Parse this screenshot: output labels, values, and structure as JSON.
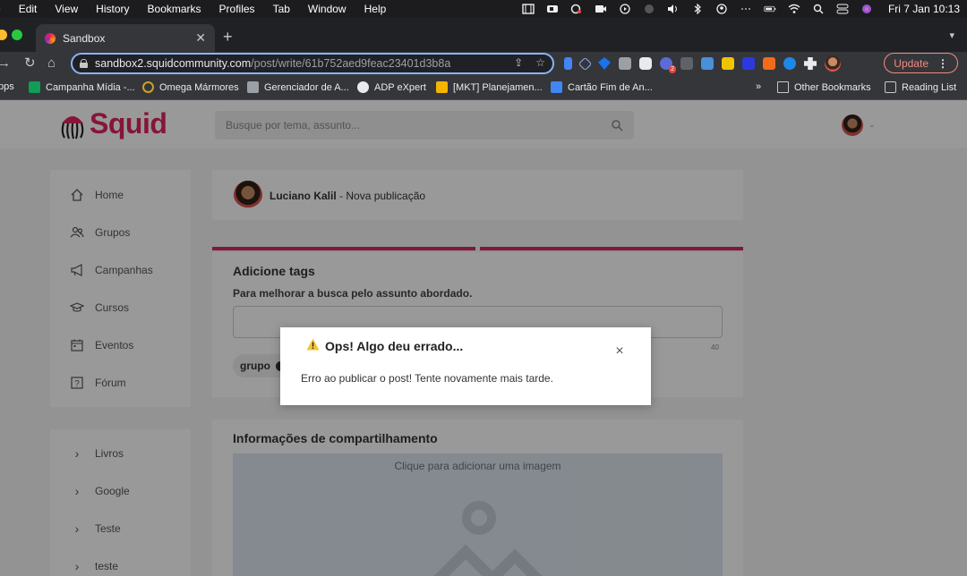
{
  "menubar": {
    "app_partial": "e",
    "items": [
      "Edit",
      "View",
      "History",
      "Bookmarks",
      "Profiles",
      "Tab",
      "Window",
      "Help"
    ],
    "clock": "Fri 7 Jan  10:13"
  },
  "tab": {
    "title": "Sandbox"
  },
  "omnibox": {
    "host": "sandbox2.squidcommunity.com",
    "path": "/post/write/61b752aed9feac23401d3b8a"
  },
  "toolbar": {
    "update_label": "Update",
    "extension_badge": "2"
  },
  "bookmarks": {
    "apps_partial": "pps",
    "items": [
      "Campanha Mídia -...",
      "Omega Mármores",
      "Gerenciador de A...",
      "ADP eXpert",
      "[MKT] Planejamen...",
      "Cartão Fim de An..."
    ],
    "overflow": "»",
    "other": "Other Bookmarks",
    "reading_list": "Reading List"
  },
  "site": {
    "logo": "Squid",
    "search_placeholder": "Busque por tema, assunto..."
  },
  "sidebar": {
    "main_items": [
      {
        "label": "Home",
        "icon": "home-icon"
      },
      {
        "label": "Grupos",
        "icon": "groups-icon"
      },
      {
        "label": "Campanhas",
        "icon": "megaphone-icon"
      },
      {
        "label": "Cursos",
        "icon": "graduation-cap-icon"
      },
      {
        "label": "Eventos",
        "icon": "calendar-icon"
      },
      {
        "label": "Fórum",
        "icon": "question-icon"
      }
    ],
    "group_items": [
      "Livros",
      "Google",
      "Teste",
      "teste"
    ]
  },
  "post": {
    "author": "Luciano Kalil",
    "action": " - Nova publicação",
    "tags_title": "Adicione tags",
    "tags_subtitle": "Para melhorar a busca pelo assunto abordado.",
    "tags_counter": "40",
    "tag_chip": "grupo",
    "share_title": "Informações de compartilhamento",
    "image_prompt": "Clique para adicionar uma imagem"
  },
  "modal": {
    "title": "Ops! Algo deu errado...",
    "message": "Erro ao publicar o post! Tente novamente mais tarde.",
    "close": "×"
  },
  "colors": {
    "brand": "#e0245e",
    "accent_bar": "#d12c5c",
    "warning": "#f4c430"
  }
}
